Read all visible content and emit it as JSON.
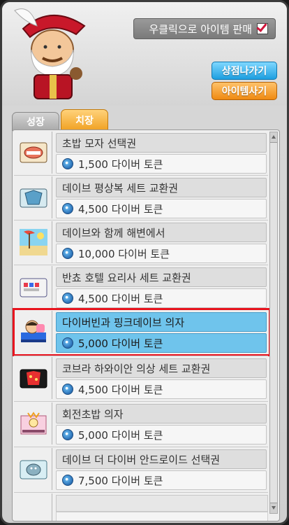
{
  "header": {
    "sell_toggle_label": "우클릭으로 아이템 판매",
    "leave_shop_label": "상점나가기",
    "buy_item_label": "아이템사기"
  },
  "tabs": [
    {
      "label": "성장"
    },
    {
      "label": "치장"
    }
  ],
  "items": [
    {
      "name": "초밥 모자 선택권",
      "price": "1,500 다이버 토큰"
    },
    {
      "name": "데이브 평상복 세트 교환권",
      "price": "4,500 다이버 토큰"
    },
    {
      "name": "데이브와 함께 해변에서",
      "price": "10,000 다이버 토큰"
    },
    {
      "name": "반쵸 호텔 요리사 세트 교환권",
      "price": "4,500 다이버 토큰"
    },
    {
      "name": "다이버빈과 핑크데이브 의자",
      "price": "5,000 다이버 토큰"
    },
    {
      "name": "코브라 하와이안 의상 세트 교환권",
      "price": "4,500 다이버 토큰"
    },
    {
      "name": "회전초밥 의자",
      "price": "5,000 다이버 토큰"
    },
    {
      "name": "데이브 더 다이버 안드로이드 선택권",
      "price": "7,500 다이버 토큰"
    }
  ],
  "selected_item": "다이버빈과 핑크데이브 의자",
  "colors": {
    "selected_row": "#6fc4ec",
    "highlight_outline": "#e8141e",
    "active_tab": "#f0a020",
    "leave_button": "#1d9fe0",
    "buy_button": "#ef8a12"
  }
}
